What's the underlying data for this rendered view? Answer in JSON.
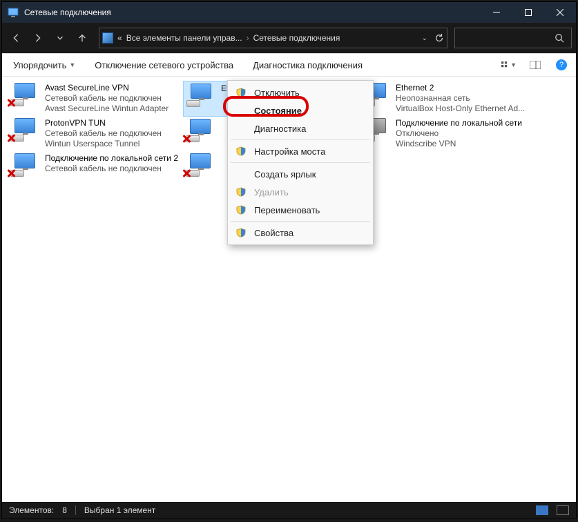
{
  "titlebar": {
    "title": "Сетевые подключения"
  },
  "breadcrumb": {
    "prefix": "«",
    "seg1": "Все элементы панели управ...",
    "seg2": "Сетевые подключения"
  },
  "toolbar": {
    "organize": "Упорядочить",
    "disable": "Отключение сетевого устройства",
    "diagnose": "Диагностика подключения"
  },
  "connections": {
    "col1": [
      {
        "name": "Avast SecureLine VPN",
        "status": "Сетевой кабель не подключен",
        "device": "Avast SecureLine Wintun Adapter",
        "disconnected": true
      },
      {
        "name": "ProtonVPN TUN",
        "status": "Сетевой кабель не подключен",
        "device": "Wintun Userspace Tunnel",
        "disconnected": true
      },
      {
        "name": "Подключение по локальной сети 2",
        "status": "Сетевой кабель не подключен",
        "device": "",
        "disconnected": true
      }
    ],
    "col2": [
      {
        "name": "Ethernet",
        "status": "",
        "device": "",
        "disconnected": false,
        "selected": true
      },
      {
        "name": "",
        "status": "",
        "device": "",
        "disconnected": true
      },
      {
        "name": "",
        "status": "",
        "device": "",
        "disconnected": true
      }
    ],
    "col3": [
      {
        "name": "Ethernet 2",
        "status": "Неопознанная сеть",
        "device": "VirtualBox Host-Only Ethernet Ad...",
        "disconnected": false
      },
      {
        "name": "Подключение по локальной сети",
        "status": "Отключено",
        "device": "Windscribe VPN",
        "disconnected": false,
        "gray": true
      }
    ]
  },
  "context_menu": {
    "disable": "Отключить",
    "status": "Состояние",
    "diagnose": "Диагностика",
    "bridge": "Настройка моста",
    "shortcut": "Создать ярлык",
    "delete": "Удалить",
    "rename": "Переименовать",
    "properties": "Свойства"
  },
  "statusbar": {
    "count_label": "Элементов:",
    "count": "8",
    "selected": "Выбран 1 элемент"
  }
}
